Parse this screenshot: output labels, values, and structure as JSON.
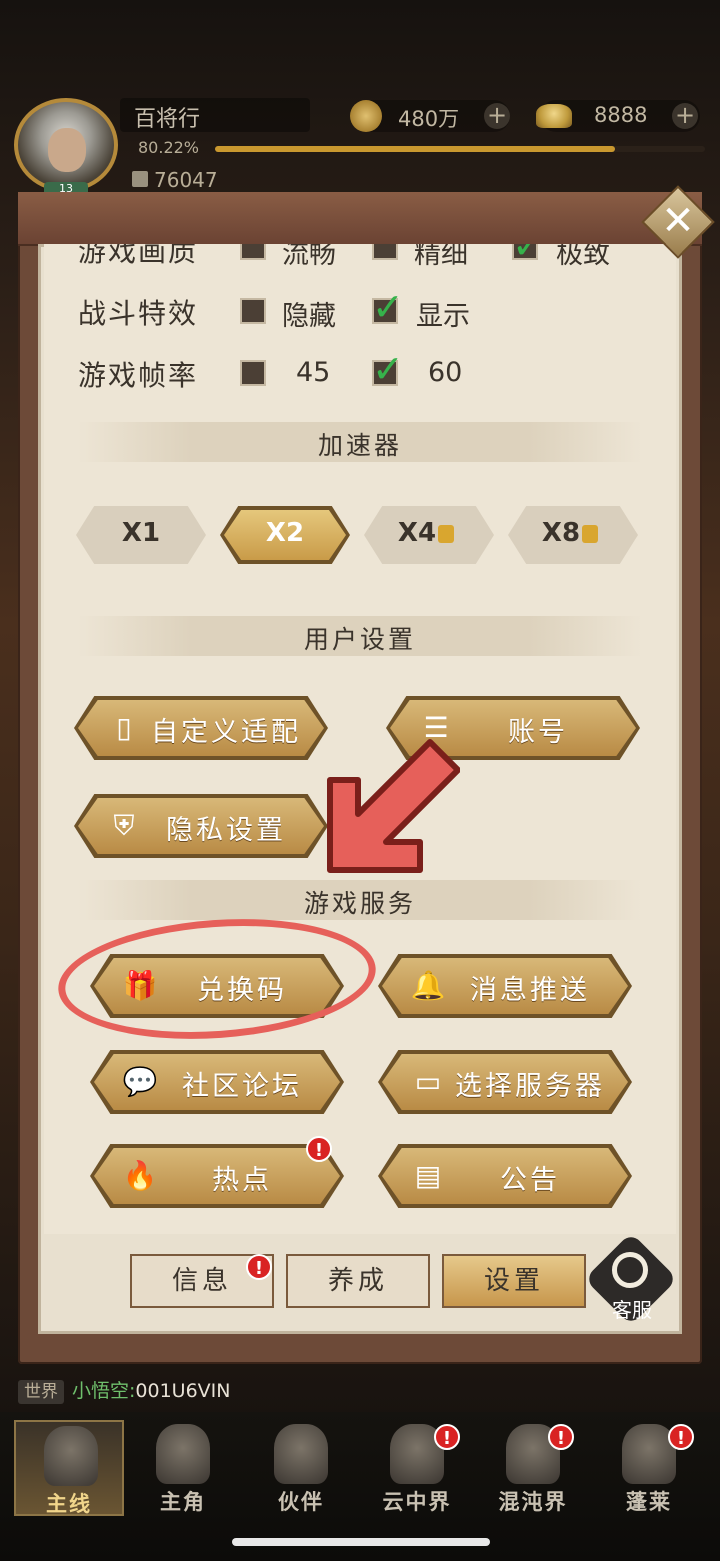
{
  "header": {
    "player_name": "百将行",
    "exp_percent": "80.22%",
    "level": "13",
    "power": "76047",
    "coins": "480万",
    "gold": "8888",
    "plus": "+"
  },
  "panel": {
    "close": "✕",
    "settings": [
      {
        "label": "游戏画质",
        "options": [
          {
            "text": "流畅",
            "checked": false
          },
          {
            "text": "精细",
            "checked": false
          },
          {
            "text": "极致",
            "checked": true
          }
        ]
      },
      {
        "label": "战斗特效",
        "options": [
          {
            "text": "隐藏",
            "checked": false
          },
          {
            "text": "显示",
            "checked": true
          }
        ]
      },
      {
        "label": "游戏帧率",
        "options": [
          {
            "text": "45",
            "checked": false
          },
          {
            "text": "60",
            "checked": true
          }
        ]
      }
    ],
    "accelerator_title": "加速器",
    "speeds": [
      "X1",
      "X2",
      "X4",
      "X8"
    ],
    "user_settings_title": "用户设置",
    "user_buttons": {
      "adapt": "自定义适配",
      "account": "账号",
      "privacy": "隐私设置"
    },
    "game_service_title": "游戏服务",
    "service_buttons": {
      "redeem": "兑换码",
      "push": "消息推送",
      "forum": "社区论坛",
      "server": "选择服务器",
      "hot": "热点",
      "notice": "公告"
    },
    "badge": "!",
    "tabs": {
      "info": "信息",
      "develop": "养成",
      "settings": "设置"
    },
    "customer_service": "客服"
  },
  "chat": {
    "channel": "世界",
    "sender": "小悟空:",
    "message": "001U6VIN"
  },
  "nav": [
    {
      "label": "主线",
      "active": true,
      "badge": false
    },
    {
      "label": "主角",
      "active": false,
      "badge": false
    },
    {
      "label": "伙伴",
      "active": false,
      "badge": false
    },
    {
      "label": "云中界",
      "active": false,
      "badge": true
    },
    {
      "label": "混沌界",
      "active": false,
      "badge": true
    },
    {
      "label": "蓬莱",
      "active": false,
      "badge": true
    }
  ],
  "colors": {
    "accent_gold": "#c99b48",
    "annotation_red": "#e6605a",
    "tick_green": "#36b24b"
  }
}
